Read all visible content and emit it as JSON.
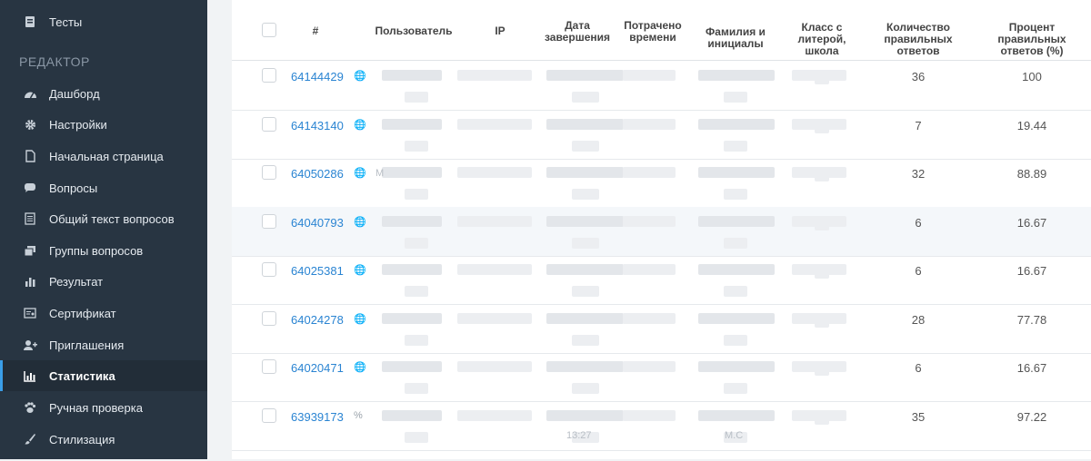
{
  "sidebar": {
    "top_item": {
      "label": "Тесты",
      "icon": "tests-icon"
    },
    "section_title": "РЕДАКТОР",
    "items": [
      {
        "label": "Дашборд",
        "icon": "dashboard-icon"
      },
      {
        "label": "Настройки",
        "icon": "gear-icon"
      },
      {
        "label": "Начальная страница",
        "icon": "page-icon"
      },
      {
        "label": "Вопросы",
        "icon": "chat-icon"
      },
      {
        "label": "Общий текст вопросов",
        "icon": "text-doc-icon"
      },
      {
        "label": "Группы вопросов",
        "icon": "stack-icon"
      },
      {
        "label": "Результат",
        "icon": "bars-icon"
      },
      {
        "label": "Сертификат",
        "icon": "certificate-icon"
      },
      {
        "label": "Приглашения",
        "icon": "add-user-icon"
      },
      {
        "label": "Статистика",
        "icon": "chart-icon",
        "active": true
      },
      {
        "label": "Ручная проверка",
        "icon": "paw-icon"
      },
      {
        "label": "Стилизация",
        "icon": "brush-icon"
      }
    ]
  },
  "table": {
    "headers": {
      "num": "#",
      "user": "Пользователь",
      "ip": "IP",
      "finish_date": "Дата завершения",
      "time_spent": "Потрачено времени",
      "name": "Фамилия и инициалы",
      "class": "Класс с литерой, школа",
      "correct_count": "Количество правильных ответов",
      "correct_percent": "Процент правильных ответов (%)"
    },
    "rows": [
      {
        "id": "64144429",
        "glyph": "🌐",
        "count": "36",
        "percent": "100"
      },
      {
        "id": "64143140",
        "glyph": "🌐",
        "count": "7",
        "percent": "19.44"
      },
      {
        "id": "64050286",
        "glyph": "🌐",
        "count": "32",
        "percent": "88.89"
      },
      {
        "id": "64040793",
        "glyph": "🌐",
        "count": "6",
        "percent": "16.67"
      },
      {
        "id": "64025381",
        "glyph": "🌐",
        "count": "6",
        "percent": "16.67"
      },
      {
        "id": "64024278",
        "glyph": "🌐",
        "count": "28",
        "percent": "77.78"
      },
      {
        "id": "64020471",
        "glyph": "🌐",
        "count": "6",
        "percent": "16.67"
      },
      {
        "id": "63939173",
        "glyph": "%",
        "count": "35",
        "percent": "97.22"
      }
    ],
    "leaks": {
      "date_fragment": "13:27",
      "name_fragment": "М.С",
      "user_fragment": "М"
    }
  }
}
